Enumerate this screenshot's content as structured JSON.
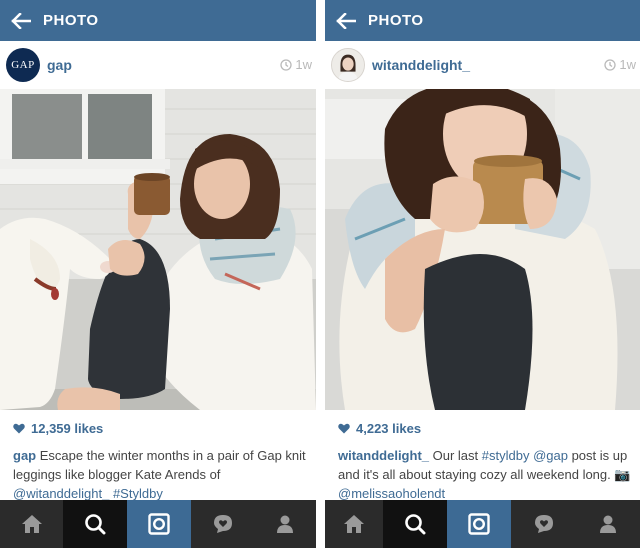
{
  "screens": [
    {
      "title": "PHOTO",
      "username": "gap",
      "avatar_text": "GAP",
      "time": "1w",
      "likes": "12,359 likes",
      "caption": {
        "author": "gap",
        "text": " Escape the winter months in a pair of Gap knit leggings like blogger Kate Arends of ",
        "mention": "@witanddelight_",
        "sep": " ",
        "hashtag": "#Styldby"
      }
    },
    {
      "title": "PHOTO",
      "username": "witanddelight_",
      "time": "1w",
      "likes": "4,223 likes",
      "caption": {
        "author": "witanddelight_",
        "text1": " Our last ",
        "hashtag": "#styldby",
        "sep1": " ",
        "mention1": "@gap",
        "text2": " post is up and it's all about staying cozy all weekend long. ",
        "emoji": "📷",
        "mention2": "@melissaoholendt"
      }
    }
  ],
  "tabs": [
    "home",
    "explore",
    "camera",
    "activity",
    "profile"
  ],
  "colors": {
    "appbar": "#3f6b94",
    "tabbar": "#2b2b2b",
    "tab_explore_active": "#111111",
    "tab_camera": "#3d6a94",
    "link": "#3f6b94"
  },
  "icons": [
    "back-arrow-icon",
    "clock-icon",
    "heart-icon",
    "home-icon",
    "search-icon",
    "camera-icon",
    "speech-heart-icon",
    "person-icon"
  ]
}
